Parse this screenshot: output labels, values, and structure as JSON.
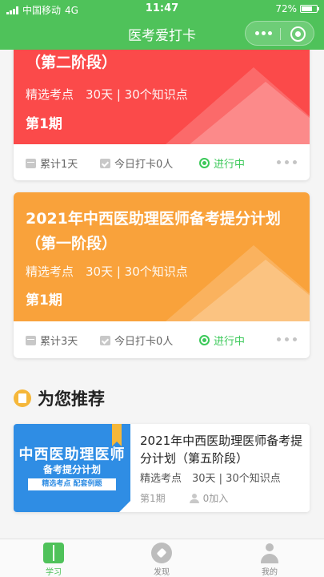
{
  "status_bar": {
    "carrier": "中国移动",
    "network": "4G",
    "time": "11:47",
    "battery": "72%",
    "battery_level": 0.72
  },
  "nav": {
    "title": "医考爱打卡"
  },
  "plans": [
    {
      "title": "（第二阶段）",
      "meta": "精选考点　30天 | 30个知识点",
      "period": "第1期",
      "accumulated": "累计1天",
      "today": "今日打卡0人",
      "status": "进行中",
      "color": "#fb4a4a"
    },
    {
      "title": "2021年中西医助理医师备考提分计划（第一阶段）",
      "meta": "精选考点　30天 | 30个知识点",
      "period": "第1期",
      "accumulated": "累计3天",
      "today": "今日打卡0人",
      "status": "进行中",
      "color": "#f9a23b"
    }
  ],
  "recommend": {
    "heading": "为您推荐",
    "course": {
      "cover_line1": "中西医助理医师",
      "cover_line2": "备考提分计划",
      "cover_line3": "精选考点 配套例题",
      "name": "2021年中西医助理医师备考提分计划（第五阶段）",
      "meta": "精选考点　30天 | 30个知识点",
      "period": "第1期",
      "joined": "0加入"
    }
  },
  "tabs": [
    {
      "label": "学习",
      "icon": "book-icon",
      "active": true
    },
    {
      "label": "发现",
      "icon": "compass-icon",
      "active": false
    },
    {
      "label": "我的",
      "icon": "user-icon",
      "active": false
    }
  ],
  "colors": {
    "brand": "#4fc25a",
    "status_green": "#3cc95a",
    "accent_orange": "#f5b73a",
    "cover_blue": "#2f8de4"
  }
}
